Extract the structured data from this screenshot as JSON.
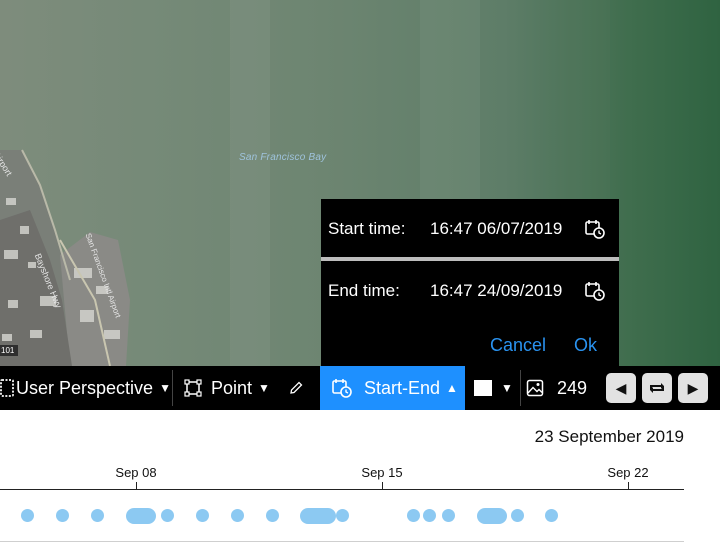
{
  "map": {
    "bay_label": "San Francisco Bay",
    "street_labels": [
      "Airport",
      "Bayshore Hwy",
      "San Francisco Intl Airport",
      "101"
    ]
  },
  "time_popup": {
    "start_label": "Start time:",
    "start_value": "16:47 06/07/2019",
    "end_label": "End time:",
    "end_value": "16:47 24/09/2019",
    "cancel_label": "Cancel",
    "ok_label": "Ok"
  },
  "toolbar": {
    "perspective_label": "User Perspective",
    "geometry_label": "Point",
    "time_mode_label": "Start-End",
    "image_count": "249",
    "colors": {
      "accent": "#1e90ff",
      "toolbar_bg": "#000000"
    }
  },
  "timeline": {
    "current_date": "23 September 2019",
    "ticks": [
      "Sep 08",
      "Sep 15",
      "Sep 22"
    ]
  }
}
